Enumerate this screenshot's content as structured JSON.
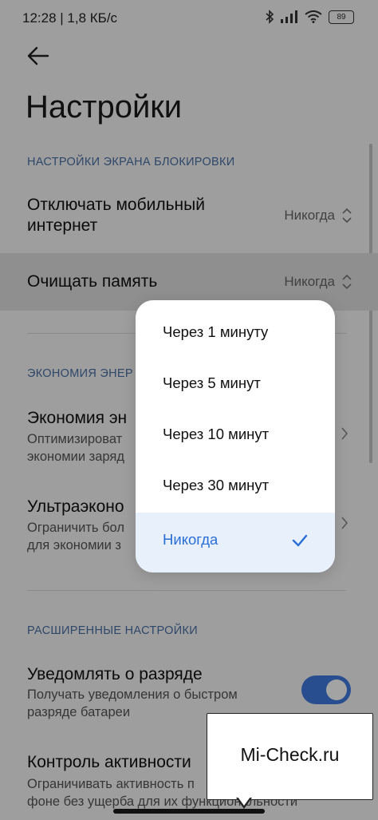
{
  "status_bar": {
    "time_speed": "12:28 | 1,8 КБ/с",
    "battery": "89"
  },
  "header": {
    "title": "Настройки"
  },
  "sections": {
    "lock_screen": "НАСТРОЙКИ ЭКРАНА БЛОКИРОВКИ",
    "power_saving": "ЭКОНОМИЯ ЭНЕР",
    "advanced": "РАСШИРЕННЫЕ НАСТРОЙКИ"
  },
  "rows": {
    "mobile_data": {
      "title_line1": "Отключать мобильный",
      "title_line2": "интернет",
      "value": "Никогда"
    },
    "clear_memory": {
      "title": "Очищать память",
      "value": "Никогда"
    },
    "power_saving": {
      "title": "Экономия эн",
      "sub_line1": "Оптимизироват",
      "sub_line2": "экономии заряд"
    },
    "ultra_saving": {
      "title": "Ультраэконо",
      "sub_line1": "Ограничить бол",
      "sub_line2": "для экономии з"
    },
    "low_battery": {
      "title": "Уведомлять о разряде",
      "sub_line1": "Получать уведомления о быстром",
      "sub_line2": "разряде батареи",
      "enabled": true
    },
    "activity": {
      "title": "Контроль активности",
      "sub_line1": "Ограничивать активность п",
      "sub_line2": "фоне без ущерба для их функциональности"
    }
  },
  "popup": {
    "options": [
      "Через 1 минуту",
      "Через 5 минут",
      "Через 10 минут",
      "Через 30 минут",
      "Никогда"
    ],
    "selected": "Никогда"
  },
  "watermark": {
    "text": "Mi-Check.ru"
  },
  "colors": {
    "accent": "#2b6fd6",
    "toggle": "#3f7be0",
    "section": "#4a6fa5"
  }
}
